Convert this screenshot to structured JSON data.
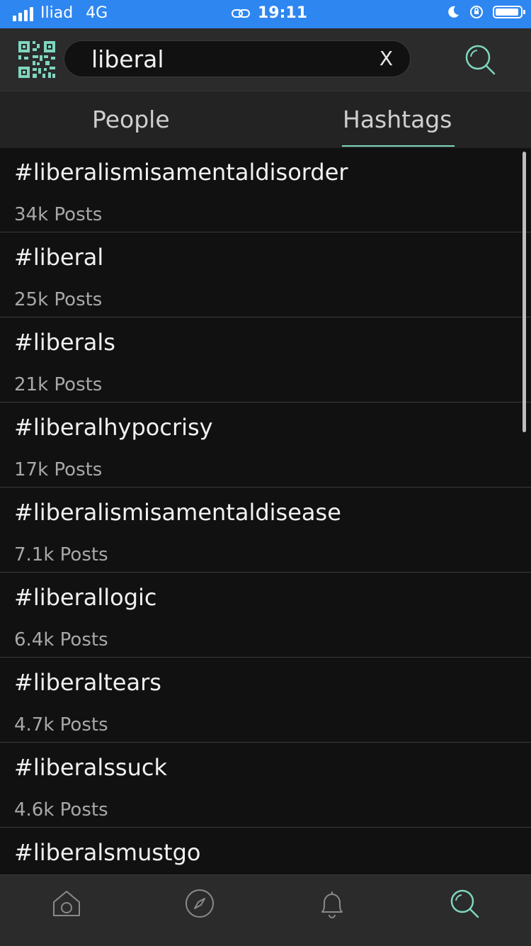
{
  "status_bar": {
    "carrier": "Iliad",
    "network": "4G",
    "time": "19:11",
    "battery_level": 0.95
  },
  "search": {
    "value": "liberal",
    "clear_label": "X"
  },
  "tabs": [
    {
      "label": "People",
      "active": false
    },
    {
      "label": "Hashtags",
      "active": true
    }
  ],
  "hashtags": [
    {
      "tag": "#liberalismisamentaldisorder",
      "count": "34k Posts"
    },
    {
      "tag": "#liberal",
      "count": "25k Posts"
    },
    {
      "tag": "#liberals",
      "count": "21k Posts"
    },
    {
      "tag": "#liberalhypocrisy",
      "count": "17k Posts"
    },
    {
      "tag": "#liberalismisamentaldisease",
      "count": "7.1k Posts"
    },
    {
      "tag": "#liberallogic",
      "count": "6.4k Posts"
    },
    {
      "tag": "#liberaltears",
      "count": "4.7k Posts"
    },
    {
      "tag": "#liberalssuck",
      "count": "4.6k Posts"
    },
    {
      "tag": "#liberalsmustgo",
      "count": ""
    }
  ],
  "nav": [
    {
      "icon": "home-icon",
      "active": false
    },
    {
      "icon": "compass-icon",
      "active": false
    },
    {
      "icon": "bell-icon",
      "active": false
    },
    {
      "icon": "search-icon",
      "active": true
    }
  ],
  "colors": {
    "accent": "#7fd6bf",
    "status_bar": "#2e86f0",
    "background": "#111111",
    "header": "#2b2b2b"
  }
}
